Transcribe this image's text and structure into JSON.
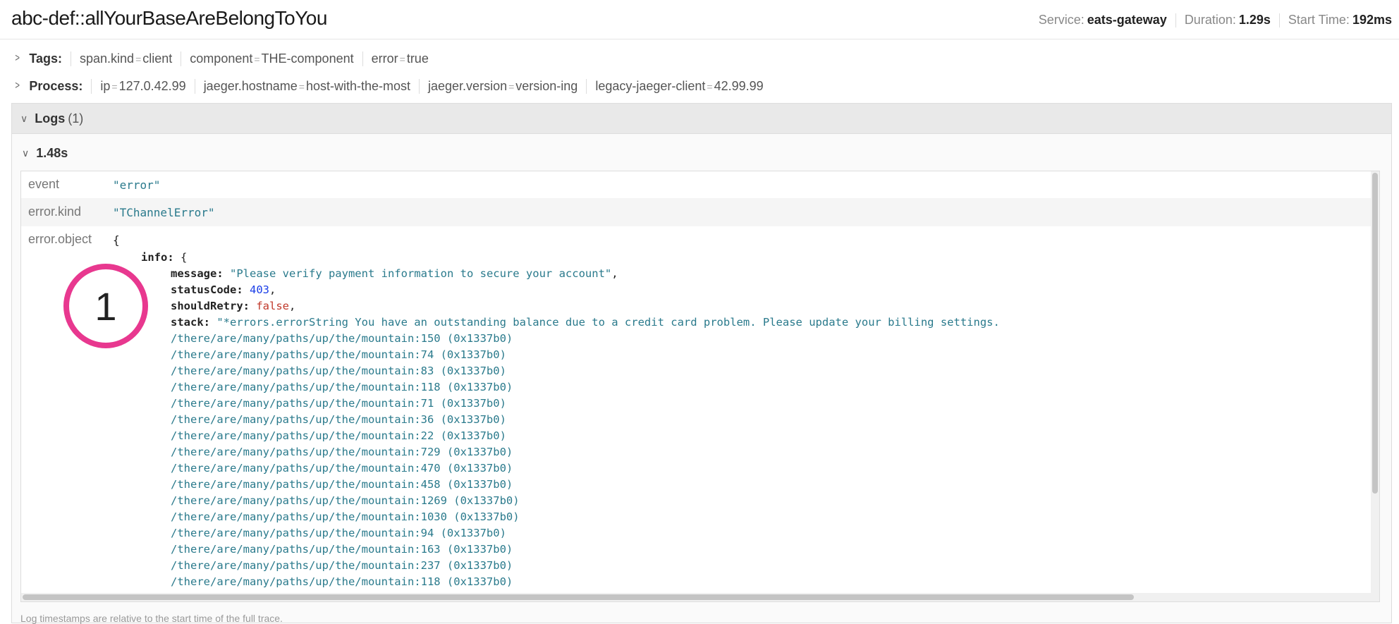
{
  "header": {
    "title": "abc-def::allYourBaseAreBelongToYou",
    "service_label": "Service:",
    "service_value": "eats-gateway",
    "duration_label": "Duration:",
    "duration_value": "1.29s",
    "start_label": "Start Time:",
    "start_value": "192ms"
  },
  "tags": {
    "label": "Tags:",
    "pairs": [
      {
        "key": "span.kind",
        "value": "client"
      },
      {
        "key": "component",
        "value": "THE-component"
      },
      {
        "key": "error",
        "value": "true"
      }
    ]
  },
  "process": {
    "label": "Process:",
    "pairs": [
      {
        "key": "ip",
        "value": "127.0.42.99"
      },
      {
        "key": "jaeger.hostname",
        "value": "host-with-the-most"
      },
      {
        "key": "jaeger.version",
        "value": "version-ing"
      },
      {
        "key": "legacy-jaeger-client",
        "value": "42.99.99"
      }
    ]
  },
  "eq_sign": "=",
  "logs": {
    "label": "Logs",
    "count": "(1)",
    "timestamp": "1.48s",
    "rows": [
      {
        "key": "event",
        "value": "\"error\""
      },
      {
        "key": "error.kind",
        "value": "\"TChannelError\""
      },
      {
        "key": "error.object",
        "value": "{"
      }
    ],
    "object": {
      "info_key": "info:",
      "info_open": " {",
      "message_key": "message:",
      "message_value": "\"Please verify payment information to secure your account\"",
      "status_key": "statusCode:",
      "status_value": "403",
      "retry_key": "shouldRetry:",
      "retry_value": "false",
      "stack_key": "stack:",
      "stack_first": "\"*errors.errorString You have an outstanding balance due to a credit card problem. Please update your billing settings.",
      "stack_lines": [
        "/there/are/many/paths/up/the/mountain:150 (0x1337b0)",
        "/there/are/many/paths/up/the/mountain:74 (0x1337b0)",
        "/there/are/many/paths/up/the/mountain:83 (0x1337b0)",
        "/there/are/many/paths/up/the/mountain:118 (0x1337b0)",
        "/there/are/many/paths/up/the/mountain:71 (0x1337b0)",
        "/there/are/many/paths/up/the/mountain:36 (0x1337b0)",
        "/there/are/many/paths/up/the/mountain:22 (0x1337b0)",
        "/there/are/many/paths/up/the/mountain:729 (0x1337b0)",
        "/there/are/many/paths/up/the/mountain:470 (0x1337b0)",
        "/there/are/many/paths/up/the/mountain:458 (0x1337b0)",
        "/there/are/many/paths/up/the/mountain:1269 (0x1337b0)",
        "/there/are/many/paths/up/the/mountain:1030 (0x1337b0)",
        "/there/are/many/paths/up/the/mountain:94 (0x1337b0)",
        "/there/are/many/paths/up/the/mountain:163 (0x1337b0)",
        "/there/are/many/paths/up/the/mountain:237 (0x1337b0)",
        "/there/are/many/paths/up/the/mountain:118 (0x1337b0)"
      ]
    },
    "footnote": "Log timestamps are relative to the start time of the full trace."
  },
  "annotation": {
    "number": "1",
    "color": "#e8388f"
  },
  "icons": {
    "collapsed": "chevron-right-icon",
    "expanded": "chevron-down-icon"
  }
}
